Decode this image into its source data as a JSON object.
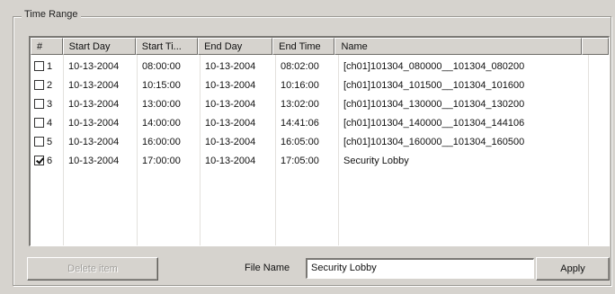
{
  "group": {
    "title": "Time Range"
  },
  "list": {
    "columns": [
      "#",
      "Start Day",
      "Start Ti...",
      "End Day",
      "End Time",
      "Name"
    ],
    "rows": [
      {
        "checked": false,
        "num": "1",
        "start_day": "10-13-2004",
        "start_time": "08:00:00",
        "end_day": "10-13-2004",
        "end_time": "08:02:00",
        "name": "[ch01]101304_080000__101304_080200"
      },
      {
        "checked": false,
        "num": "2",
        "start_day": "10-13-2004",
        "start_time": "10:15:00",
        "end_day": "10-13-2004",
        "end_time": "10:16:00",
        "name": "[ch01]101304_101500__101304_101600"
      },
      {
        "checked": false,
        "num": "3",
        "start_day": "10-13-2004",
        "start_time": "13:00:00",
        "end_day": "10-13-2004",
        "end_time": "13:02:00",
        "name": "[ch01]101304_130000__101304_130200"
      },
      {
        "checked": false,
        "num": "4",
        "start_day": "10-13-2004",
        "start_time": "14:00:00",
        "end_day": "10-13-2004",
        "end_time": "14:41:06",
        "name": "[ch01]101304_140000__101304_144106"
      },
      {
        "checked": false,
        "num": "5",
        "start_day": "10-13-2004",
        "start_time": "16:00:00",
        "end_day": "10-13-2004",
        "end_time": "16:05:00",
        "name": "[ch01]101304_160000__101304_160500"
      },
      {
        "checked": true,
        "num": "6",
        "start_day": "10-13-2004",
        "start_time": "17:00:00",
        "end_day": "10-13-2004",
        "end_time": "17:05:00",
        "name": "Security Lobby"
      }
    ]
  },
  "buttons": {
    "delete_label": "Delete item",
    "apply_label": "Apply"
  },
  "file_name": {
    "label": "File Name",
    "value": "Security Lobby"
  }
}
